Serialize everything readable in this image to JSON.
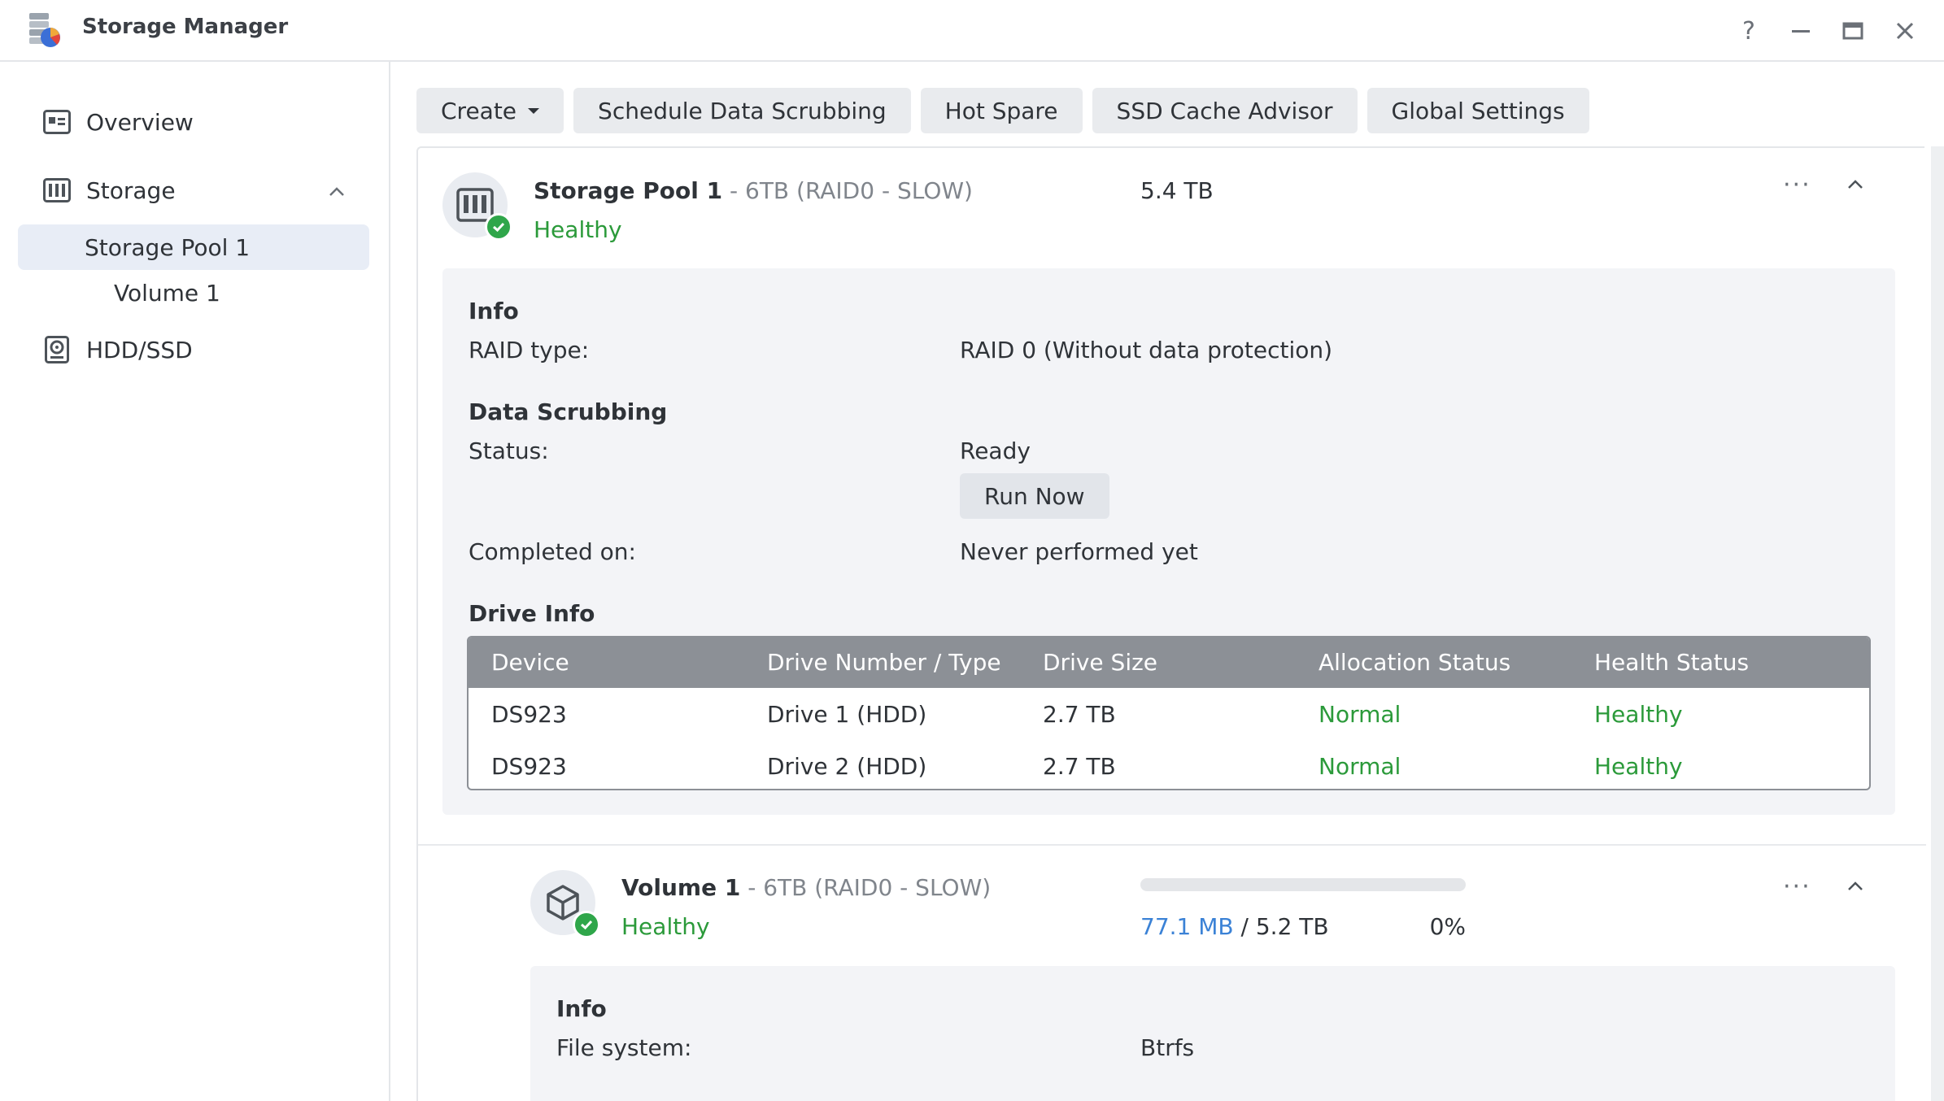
{
  "window": {
    "title": "Storage Manager",
    "help_glyph": "?",
    "minimize_glyph": "—",
    "maximize_glyph": "▭",
    "close_glyph": "✕"
  },
  "sidebar": {
    "items": [
      {
        "label": "Overview",
        "icon": "overview-icon"
      },
      {
        "label": "Storage",
        "icon": "storage-icon",
        "expanded": true
      },
      {
        "label": "Storage Pool 1",
        "selected": true
      },
      {
        "label": "Volume 1"
      },
      {
        "label": "HDD/SSD",
        "icon": "hdd-icon"
      }
    ]
  },
  "toolbar": {
    "create": "Create",
    "schedule": "Schedule Data Scrubbing",
    "hot_spare": "Hot Spare",
    "ssd_cache": "SSD Cache Advisor",
    "global": "Global Settings"
  },
  "pool": {
    "name": "Storage Pool 1",
    "spec": " - 6TB (RAID0 - SLOW)",
    "size": "5.4 TB",
    "status": "Healthy",
    "more": "···",
    "info_title": "Info",
    "raid_label": "RAID type:",
    "raid_value": "RAID 0 (Without data protection)",
    "scrub_title": "Data Scrubbing",
    "status_label": "Status:",
    "status_value": "Ready",
    "run_now": "Run Now",
    "completed_label": "Completed on:",
    "completed_value": "Never performed yet",
    "drive_title": "Drive Info",
    "columns": [
      "Device",
      "Drive Number / Type",
      "Drive Size",
      "Allocation Status",
      "Health Status"
    ],
    "drives": [
      {
        "device": "DS923",
        "number": "Drive 1 (HDD)",
        "size": "2.7 TB",
        "allocation": "Normal",
        "health": "Healthy"
      },
      {
        "device": "DS923",
        "number": "Drive 2 (HDD)",
        "size": "2.7 TB",
        "allocation": "Normal",
        "health": "Healthy"
      }
    ]
  },
  "volume": {
    "name": "Volume 1",
    "spec": " - 6TB (RAID0 - SLOW)",
    "status": "Healthy",
    "used": "77.1 MB",
    "separator": " / ",
    "total": "5.2 TB",
    "percent": "0%",
    "usage_fraction": 0.0,
    "more": "···",
    "info_title": "Info",
    "fs_label": "File system:",
    "fs_value": "Btrfs"
  },
  "colors": {
    "healthy": "#2b9a3a",
    "link": "#3b82d6",
    "table_header": "#8c9096",
    "selected_bg": "#e8edf6"
  }
}
